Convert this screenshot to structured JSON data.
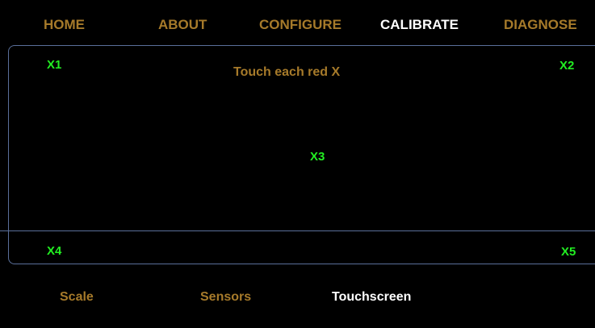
{
  "top_nav": {
    "items": [
      {
        "label": "HOME"
      },
      {
        "label": "ABOUT"
      },
      {
        "label": "CONFIGURE"
      },
      {
        "label": "CALIBRATE"
      },
      {
        "label": "DIAGNOSE"
      }
    ],
    "active": "CALIBRATE"
  },
  "calibration": {
    "instruction": "Touch each red X",
    "targets": [
      "X1",
      "X2",
      "X3",
      "X4",
      "X5"
    ]
  },
  "sub_nav": {
    "items": [
      {
        "label": "Scale"
      },
      {
        "label": "Sensors"
      },
      {
        "label": "Touchscreen"
      }
    ],
    "active": "Touchscreen"
  },
  "colors": {
    "background": "#000000",
    "nav_inactive": "#a67a2a",
    "nav_active": "#ffffff",
    "target": "#22ee22",
    "border": "#5a6f9a"
  }
}
